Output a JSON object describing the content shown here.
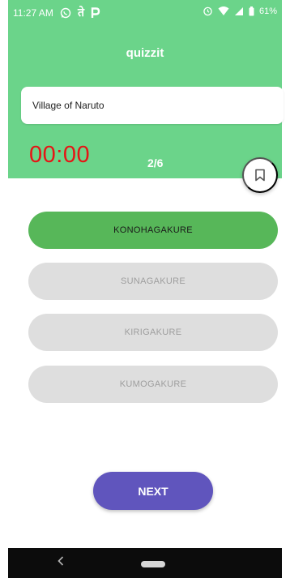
{
  "status_bar": {
    "time": "11:27 AM",
    "battery": "61%",
    "icons": [
      "whatsapp-icon",
      "devanagari-app-icon",
      "paytm-icon",
      "alarm-icon",
      "wifi-icon",
      "signal-icon",
      "battery-icon"
    ]
  },
  "header": {
    "title": "quizzit",
    "question": "Village of Naruto",
    "timer": "00:00",
    "progress": "2/6",
    "bookmark_icon": "bookmark-icon"
  },
  "options": [
    {
      "label": "KONOHAGAKURE",
      "selected": true
    },
    {
      "label": "SUNAGAKURE",
      "selected": false
    },
    {
      "label": "KIRIGAKURE",
      "selected": false
    },
    {
      "label": "KUMOGAKURE",
      "selected": false
    }
  ],
  "next_label": "NEXT",
  "colors": {
    "header": "#6bd48a",
    "timer": "#e51616",
    "selected_option": "#57b759",
    "option": "#dedede",
    "next_button": "#6055bd",
    "nav_bar": "#0c0c0c"
  }
}
